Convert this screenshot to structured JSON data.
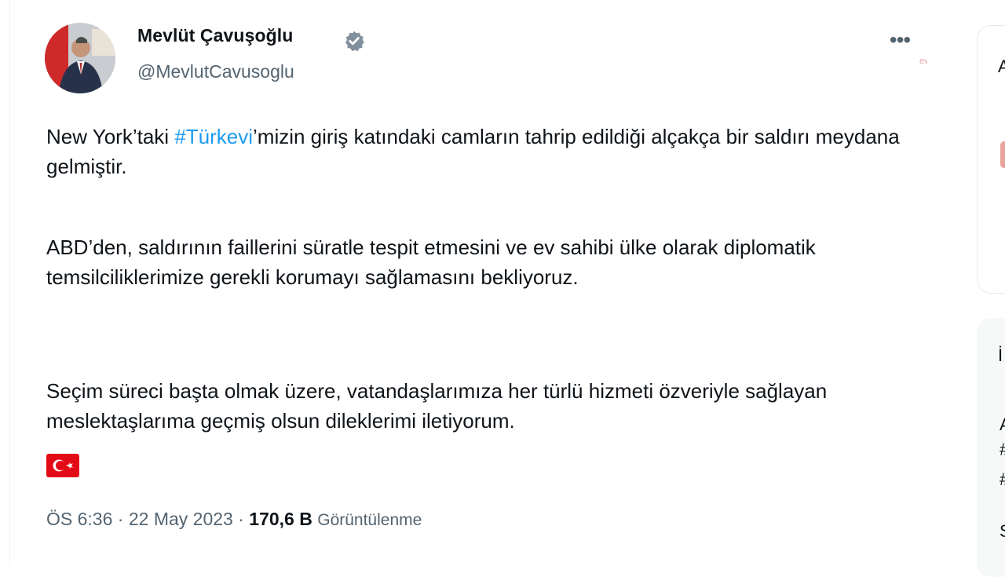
{
  "tweet": {
    "author_name": "Mevlüt Çavuşoğlu",
    "handle": "@MevlutCavusoglu",
    "watermark": "evrim",
    "more_icon": "more-horizontal-icon",
    "verified_icon": "verified-badge-icon",
    "verified_color": "#1d9bf0",
    "paragraph1_before": "New York’taki ",
    "hashtag": "#Türkevi",
    "paragraph1_after": "’mizin giriş katındaki camların tahrip edildiği alçakça bir saldırı meydana gelmiştir.",
    "paragraph2": "ABD’den, saldırının faillerini süratle tespit etmesini ve ev sahibi ülke olarak diplomatik temsilciliklerimize gerekli korumayı sağlamasını bekliyoruz.",
    "paragraph3": "Seçim süreci başta olmak üzere, vatandaşlarımıza her türlü hizmeti özveriyle sağlayan meslektaşlarıma geçmiş olsun dileklerimi iletiyorum.",
    "flag_icon": "turkey-flag-icon",
    "time": "ÖS 6:36",
    "separator": "·",
    "date": "22 May 2023",
    "views_count": "170,6 B",
    "views_label": "Görüntülenme",
    "hashtag_color": "#1d9bf0"
  },
  "right_column": {
    "fragments": [
      "A",
      "İ",
      "A",
      "#",
      "#",
      "S"
    ]
  }
}
